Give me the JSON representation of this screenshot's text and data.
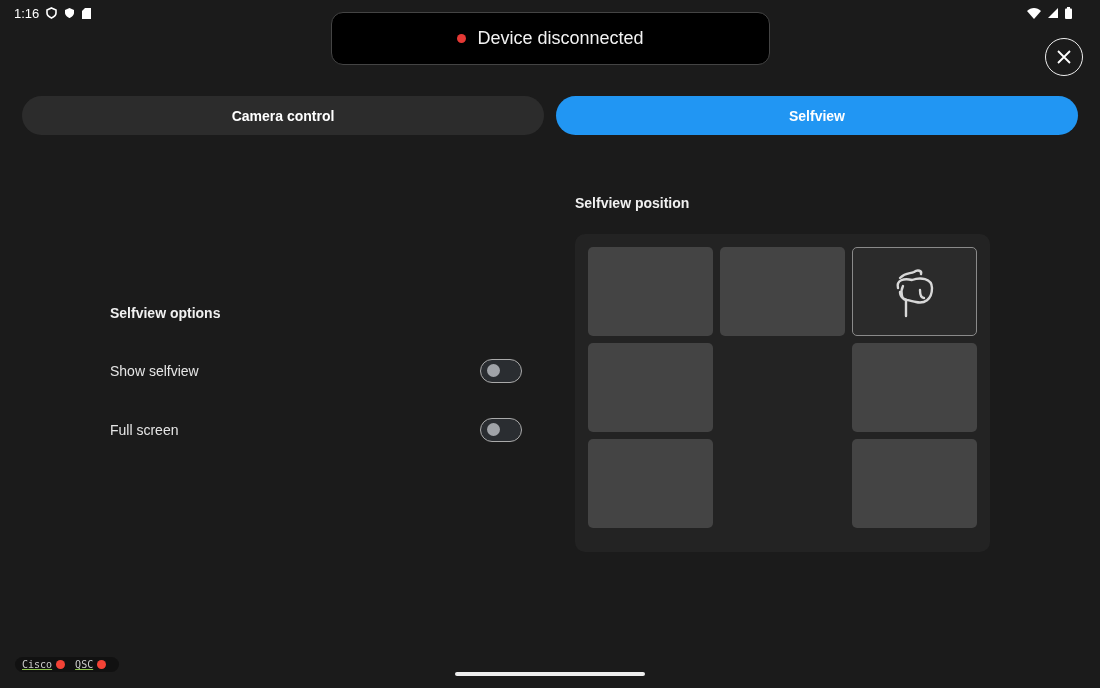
{
  "status_bar": {
    "time": "1:16"
  },
  "toast": {
    "text": "Device disconnected",
    "color": "#e53935"
  },
  "tabs": [
    {
      "label": "Camera control",
      "selected": false
    },
    {
      "label": "Selfview",
      "selected": true
    }
  ],
  "options": {
    "heading": "Selfview options",
    "toggles": [
      {
        "label": "Show selfview",
        "on": false
      },
      {
        "label": "Full screen",
        "on": false
      }
    ]
  },
  "position": {
    "heading": "Selfview position",
    "cells": [
      {
        "kind": "tile",
        "selected": false
      },
      {
        "kind": "tile",
        "selected": false
      },
      {
        "kind": "tile",
        "selected": true
      },
      {
        "kind": "tile",
        "selected": false
      },
      {
        "kind": "empty"
      },
      {
        "kind": "tile",
        "selected": false
      },
      {
        "kind": "tile",
        "selected": false
      },
      {
        "kind": "empty"
      },
      {
        "kind": "tile",
        "selected": false
      }
    ]
  },
  "connections": [
    {
      "label": "Cisco",
      "color": "#f44336"
    },
    {
      "label": "QSC",
      "color": "#f44336"
    }
  ]
}
